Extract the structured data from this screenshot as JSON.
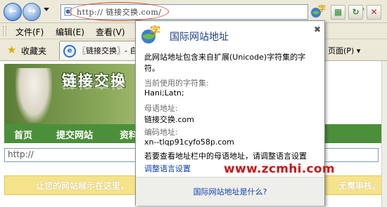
{
  "address_bar": {
    "url": "http:// 链接交换.com/"
  },
  "menu": {
    "items": [
      "文件(F)",
      "编辑(E)",
      "查看(V)"
    ]
  },
  "favorites": {
    "label": "收藏夹"
  },
  "tab": {
    "title": "〖链接交换〗- 自"
  },
  "toolbar": {
    "page_label": "页面(P) ▾"
  },
  "website": {
    "banner_title": "链接交换",
    "nav": [
      "首页",
      "提交网站",
      "资料"
    ],
    "url_input_value": "http://",
    "promo_text": "让您的网站展示在这里，",
    "promo_tail": "无需审核。"
  },
  "idn_popup": {
    "title": "国际网站地址",
    "description": "此网站地址包含来自扩展(Unicode)字符集的字符。",
    "charset_label": "当前使用的字符集:",
    "charset_value": "Hani;Latn;",
    "native_label": "母语地址:",
    "native_value": "链接交换.com",
    "encoded_label": "编码地址:",
    "encoded_value": "xn--tlqp91cyfo58p.com",
    "hint": "若要查看地址栏中的母语地址，请调整语言设置",
    "settings_link": "调整语言设置",
    "footer_link": "国际网站地址是什么?"
  },
  "watermark": "www.zcmhi.com",
  "colors": {
    "nav_green": "#4c8f3a",
    "link_blue": "#0a3fb0",
    "watermark_red": "#c81818"
  }
}
